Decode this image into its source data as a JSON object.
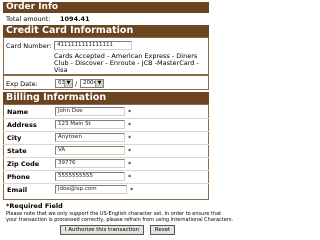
{
  "order_info": {
    "heading": "Order Info",
    "total_label": "Total amount:",
    "total_value": "1094.41"
  },
  "credit_card": {
    "heading": "Credit Card Information",
    "card_number_label": "Card Number:",
    "card_number_value": "4111111111111111",
    "cards_accepted_line1": "Cards Accepted - American Express - Diners",
    "cards_accepted_line2": "Club - Discover - Enroute - JCB -MasterCard -",
    "cards_accepted_line3": "Visa",
    "exp_label": "Exp Date:",
    "exp_month": "03",
    "exp_separator": "/",
    "exp_year": "2004"
  },
  "billing": {
    "heading": "Billing Information",
    "fields": [
      {
        "label": "Name",
        "value": "John Doe",
        "required": "*"
      },
      {
        "label": "Address",
        "value": "123 Main St",
        "required": "*"
      },
      {
        "label": "City",
        "value": "Anytown",
        "required": "*"
      },
      {
        "label": "State",
        "value": "VA",
        "required": "*"
      },
      {
        "label": "Zip Code",
        "value": "39776",
        "required": "*"
      },
      {
        "label": "Phone",
        "value": "5555555555",
        "required": "*"
      },
      {
        "label": "Email",
        "value": "jdoe@isp.com",
        "required": "*"
      }
    ],
    "required_note": "*Required Field",
    "notice_line1": "Please note that we only support the US-English character set. In order to ensure that",
    "notice_line2": "your transaction is processed correctly, please refrain from using International Characters."
  },
  "buttons": {
    "authorize": "I Authorize this transaction",
    "reset": "Reset"
  },
  "colors": {
    "header_bar": "#6b4420",
    "header_text": "#ffffff"
  }
}
